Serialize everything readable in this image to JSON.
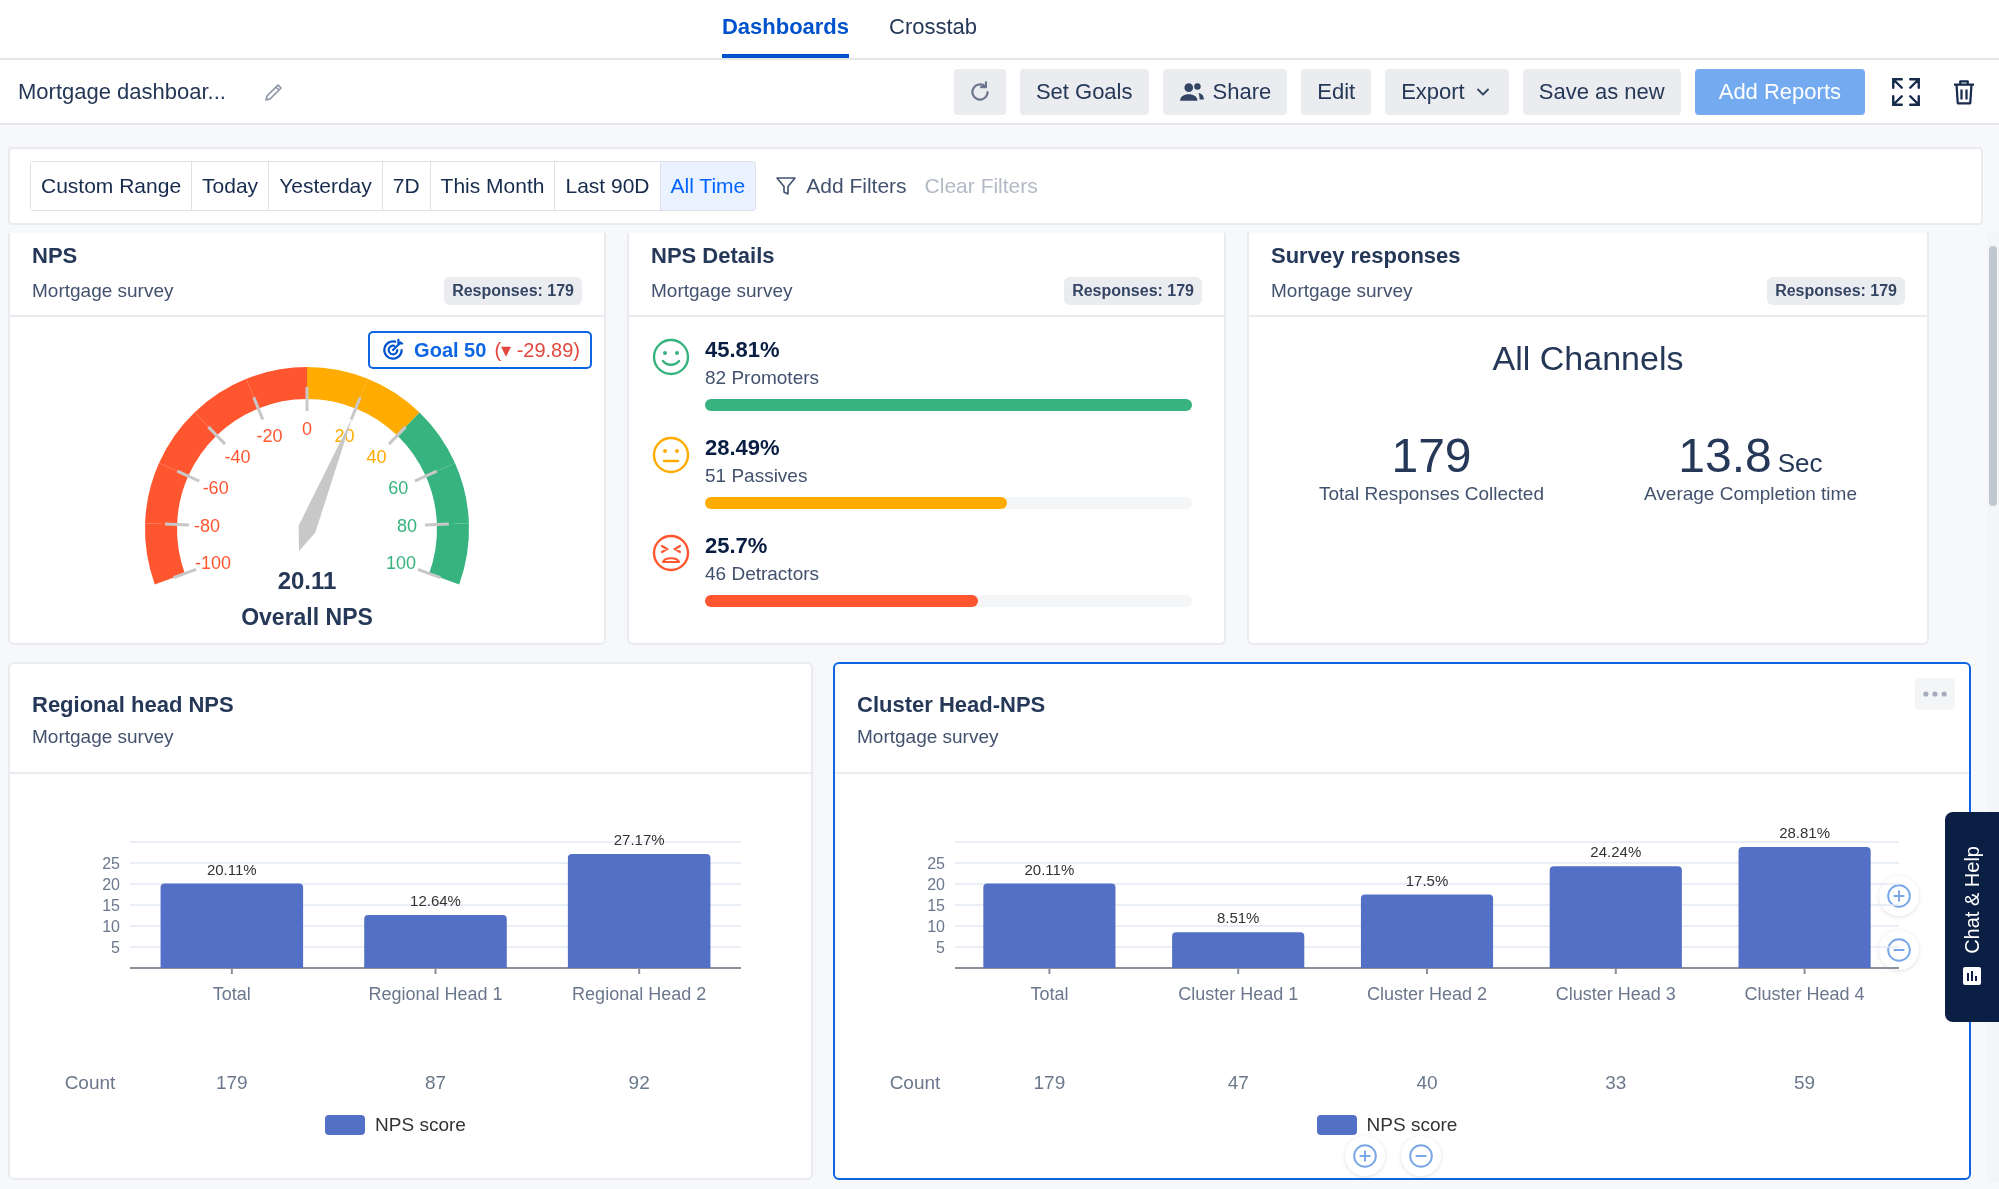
{
  "tabs": [
    {
      "label": "Dashboards",
      "selected": true
    },
    {
      "label": "Crosstab",
      "selected": false
    }
  ],
  "toolbar": {
    "title": "Mortgage dashboar...",
    "buttons": [
      {
        "kind": "refresh"
      },
      {
        "kind": "text",
        "label": "Set Goals"
      },
      {
        "kind": "share",
        "label": "Share"
      },
      {
        "kind": "text",
        "label": "Edit"
      },
      {
        "kind": "dropdown",
        "label": "Export"
      },
      {
        "kind": "text",
        "label": "Save as new"
      },
      {
        "kind": "primary",
        "label": "Add Reports"
      },
      {
        "kind": "fullscreen"
      },
      {
        "kind": "delete"
      }
    ]
  },
  "filter_bar": {
    "date_ranges": [
      {
        "label": "Custom Range",
        "selected": false
      },
      {
        "label": "Today",
        "selected": false
      },
      {
        "label": "Yesterday",
        "selected": false
      },
      {
        "label": "7D",
        "selected": false
      },
      {
        "label": "This Month",
        "selected": false
      },
      {
        "label": "Last 90D",
        "selected": false
      },
      {
        "label": "All Time",
        "selected": true
      }
    ],
    "add_filters": "Add Filters",
    "clear_filters": {
      "label": "Clear Filters",
      "disabled": true
    }
  },
  "top_cards": [
    {
      "kind": "gauge",
      "title": "NPS",
      "subtitle": "Mortgage survey",
      "badge": "Responses: 179",
      "selected": false,
      "goal": {
        "label": "Goal 50",
        "delta": "(▾ -29.89)"
      },
      "gauge": {
        "value": "20.11",
        "label": "Overall NPS",
        "ticks": [
          {
            "label": "0",
            "color": "#ff5630"
          },
          {
            "label": "-20",
            "color": "#ff5630"
          },
          {
            "label": "20",
            "color": "#ffab00"
          },
          {
            "label": "-40",
            "color": "#ff5630"
          },
          {
            "label": "40",
            "color": "#ffab00"
          },
          {
            "label": "-60",
            "color": "#ff5630"
          },
          {
            "label": "60",
            "color": "#36b37e"
          },
          {
            "label": "-80",
            "color": "#ff5630"
          },
          {
            "label": "80",
            "color": "#36b37e"
          },
          {
            "label": "-100",
            "color": "#ff5630"
          },
          {
            "label": "100",
            "color": "#36b37e"
          }
        ]
      }
    },
    {
      "kind": "nps_details",
      "title": "NPS Details",
      "subtitle": "Mortgage survey",
      "badge": "Responses: 179",
      "selected": false,
      "rows": [
        {
          "kind": "promoter",
          "percent": "45.81%",
          "label": "82 Promoters",
          "level": 1.0,
          "color": "#36b37e"
        },
        {
          "kind": "passive",
          "percent": "28.49%",
          "label": "51 Passives",
          "level": 0.62,
          "color": "#ffab00"
        },
        {
          "kind": "detractor",
          "percent": "25.7%",
          "label": "46 Detractors",
          "level": 0.56,
          "color": "#ff5630"
        }
      ]
    },
    {
      "kind": "survey_responses",
      "title": "Survey responses",
      "subtitle": "Mortgage survey",
      "badge": "Responses: 179",
      "selected": false,
      "heading": "All Channels",
      "stats": [
        {
          "value": "179",
          "caption": "Total Responses Collected"
        },
        {
          "value": "13.8",
          "unit": "Sec",
          "caption": "Average Completion time"
        }
      ]
    }
  ],
  "bottom_cards": [
    {
      "kind": "bar_chart",
      "title": "Regional head NPS",
      "subtitle": "Mortgage survey",
      "selected": false,
      "more_menu": false,
      "zoom_controls": false,
      "chart_data": {
        "type": "bar",
        "grid": true,
        "categories": [
          "Total",
          "Regional Head 1",
          "Regional Head 2"
        ],
        "series": [
          {
            "name": "NPS score",
            "color": "#5470c6",
            "values": [
              20.11,
              12.64,
              27.17
            ]
          }
        ],
        "ylim": [
          0,
          30
        ],
        "yticks": [
          5,
          10,
          15,
          20,
          25
        ],
        "value_labels": [
          "20.11%",
          "12.64%",
          "27.17%"
        ]
      },
      "count_row": {
        "label": "Count",
        "values": [
          "179",
          "87",
          "92"
        ]
      }
    },
    {
      "kind": "bar_chart",
      "title": "Cluster Head-NPS",
      "subtitle": "Mortgage survey",
      "selected": true,
      "more_menu": true,
      "zoom_controls": true,
      "chart_data": {
        "type": "bar",
        "grid": true,
        "categories": [
          "Total",
          "Cluster  Head 1",
          "Cluster  Head 2",
          "Cluster  Head 3",
          "Cluster  Head 4"
        ],
        "series": [
          {
            "name": "NPS score",
            "color": "#5470c6",
            "values": [
              20.11,
              8.51,
              17.5,
              24.24,
              28.81
            ]
          }
        ],
        "ylim": [
          0,
          30
        ],
        "yticks": [
          5,
          10,
          15,
          20,
          25
        ],
        "value_labels": [
          "20.11%",
          "8.51%",
          "17.5%",
          "24.24%",
          "28.81%"
        ]
      },
      "count_row": {
        "label": "Count",
        "values": [
          "179",
          "47",
          "40",
          "33",
          "59"
        ]
      }
    }
  ],
  "chat_widget": {
    "label": "Chat & Help"
  }
}
